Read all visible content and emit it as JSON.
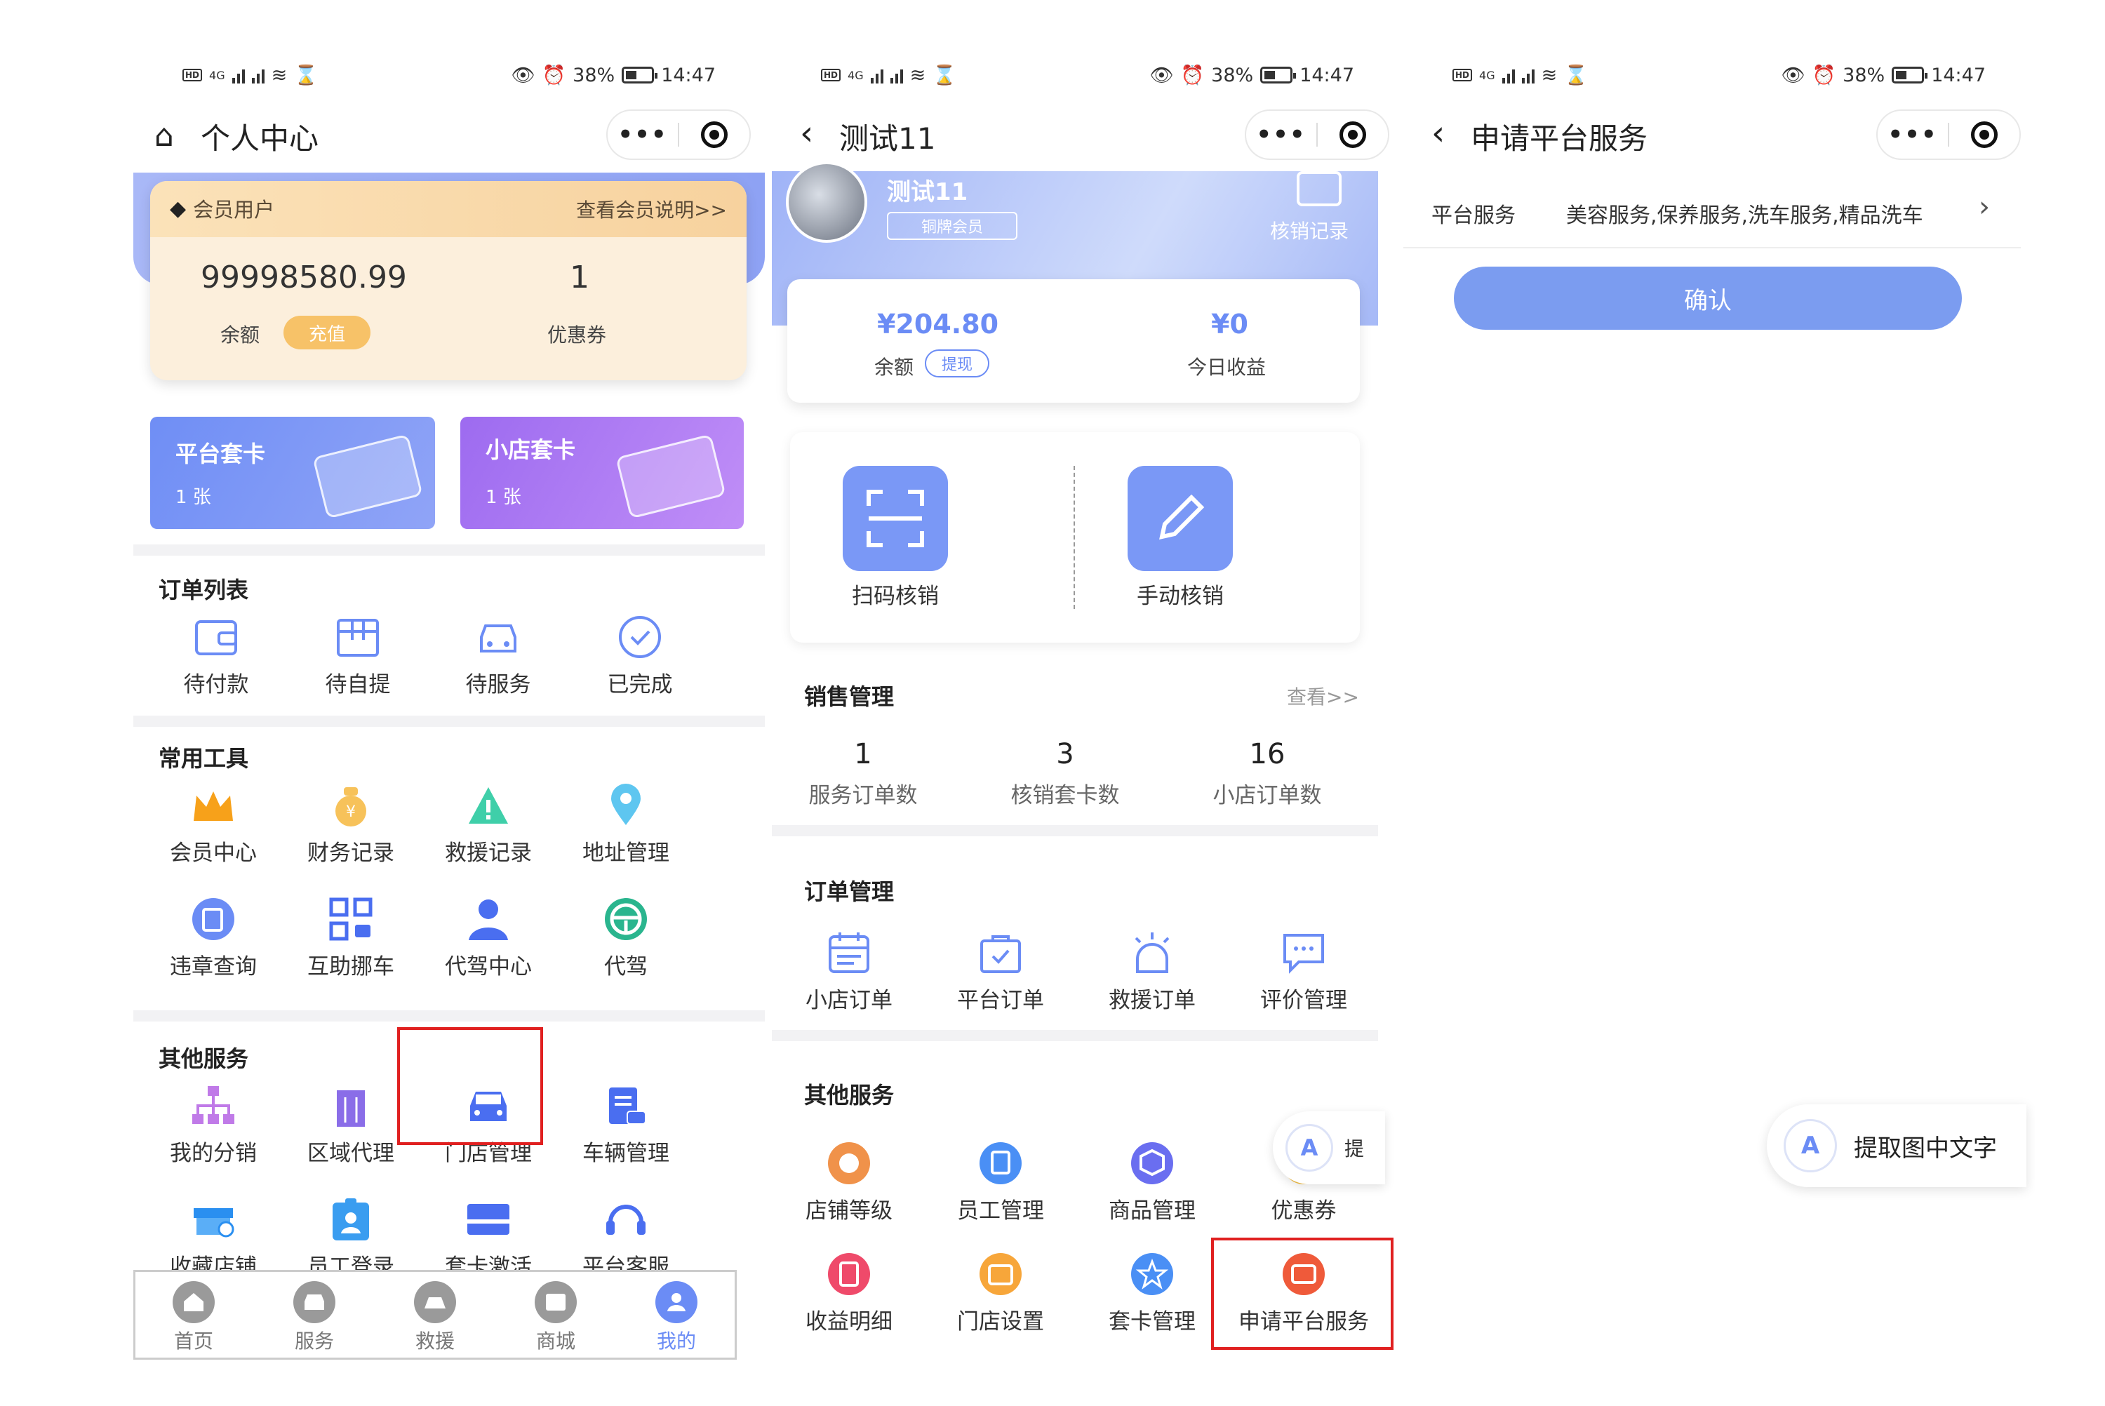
{
  "status_bar": {
    "battery": "38%",
    "time": "14:47",
    "net": "4G"
  },
  "screen1": {
    "title": "个人中心",
    "member": {
      "label": "会员用户",
      "link": "查看会员说明>>",
      "balance": "99998580.99",
      "balance_label": "余额",
      "recharge": "充值",
      "coupons": "1",
      "coupons_label": "优惠券"
    },
    "cards": [
      {
        "title": "平台套卡",
        "count": "1 张"
      },
      {
        "title": "小店套卡",
        "count": "1 张"
      }
    ],
    "orders": {
      "title": "订单列表",
      "items": [
        "待付款",
        "待自提",
        "待服务",
        "已完成"
      ]
    },
    "tools": {
      "title": "常用工具",
      "items": [
        "会员中心",
        "财务记录",
        "救援记录",
        "地址管理",
        "违章查询",
        "互助挪车",
        "代驾中心",
        "代驾"
      ]
    },
    "other": {
      "title": "其他服务",
      "items": [
        "我的分销",
        "区域代理",
        "门店管理",
        "车辆管理",
        "收藏店铺",
        "员工登录",
        "套卡激活",
        "平台客服"
      ]
    },
    "tabs": [
      "首页",
      "服务",
      "救援",
      "商城",
      "我的"
    ]
  },
  "screen2": {
    "title": "测试11",
    "profile": {
      "name": "测试11",
      "level": "铜牌会员",
      "records": "核销记录"
    },
    "balance": {
      "amount": "¥204.80",
      "label": "余额",
      "withdraw": "提现",
      "today": "¥0",
      "today_label": "今日收益"
    },
    "verify": [
      "扫码核销",
      "手动核销"
    ],
    "sales": {
      "title": "销售管理",
      "link": "查看>>",
      "stats": [
        {
          "value": "1",
          "label": "服务订单数"
        },
        {
          "value": "3",
          "label": "核销套卡数"
        },
        {
          "value": "16",
          "label": "小店订单数"
        }
      ]
    },
    "orders": {
      "title": "订单管理",
      "items": [
        "小店订单",
        "平台订单",
        "救援订单",
        "评价管理"
      ]
    },
    "other": {
      "title": "其他服务",
      "items": [
        "店铺等级",
        "员工管理",
        "商品管理",
        "优惠券",
        "收益明细",
        "门店设置",
        "套卡管理",
        "申请平台服务"
      ]
    },
    "ocr_partial": "提"
  },
  "screen3": {
    "title": "申请平台服务",
    "field_label": "平台服务",
    "field_value": "美容服务,保养服务,洗车服务,精品洗车",
    "confirm": "确认",
    "ocr": "提取图中文字"
  },
  "colors": {
    "accent": "#6b8cf5",
    "gold": "#f5b64a",
    "red": "#e02020"
  }
}
